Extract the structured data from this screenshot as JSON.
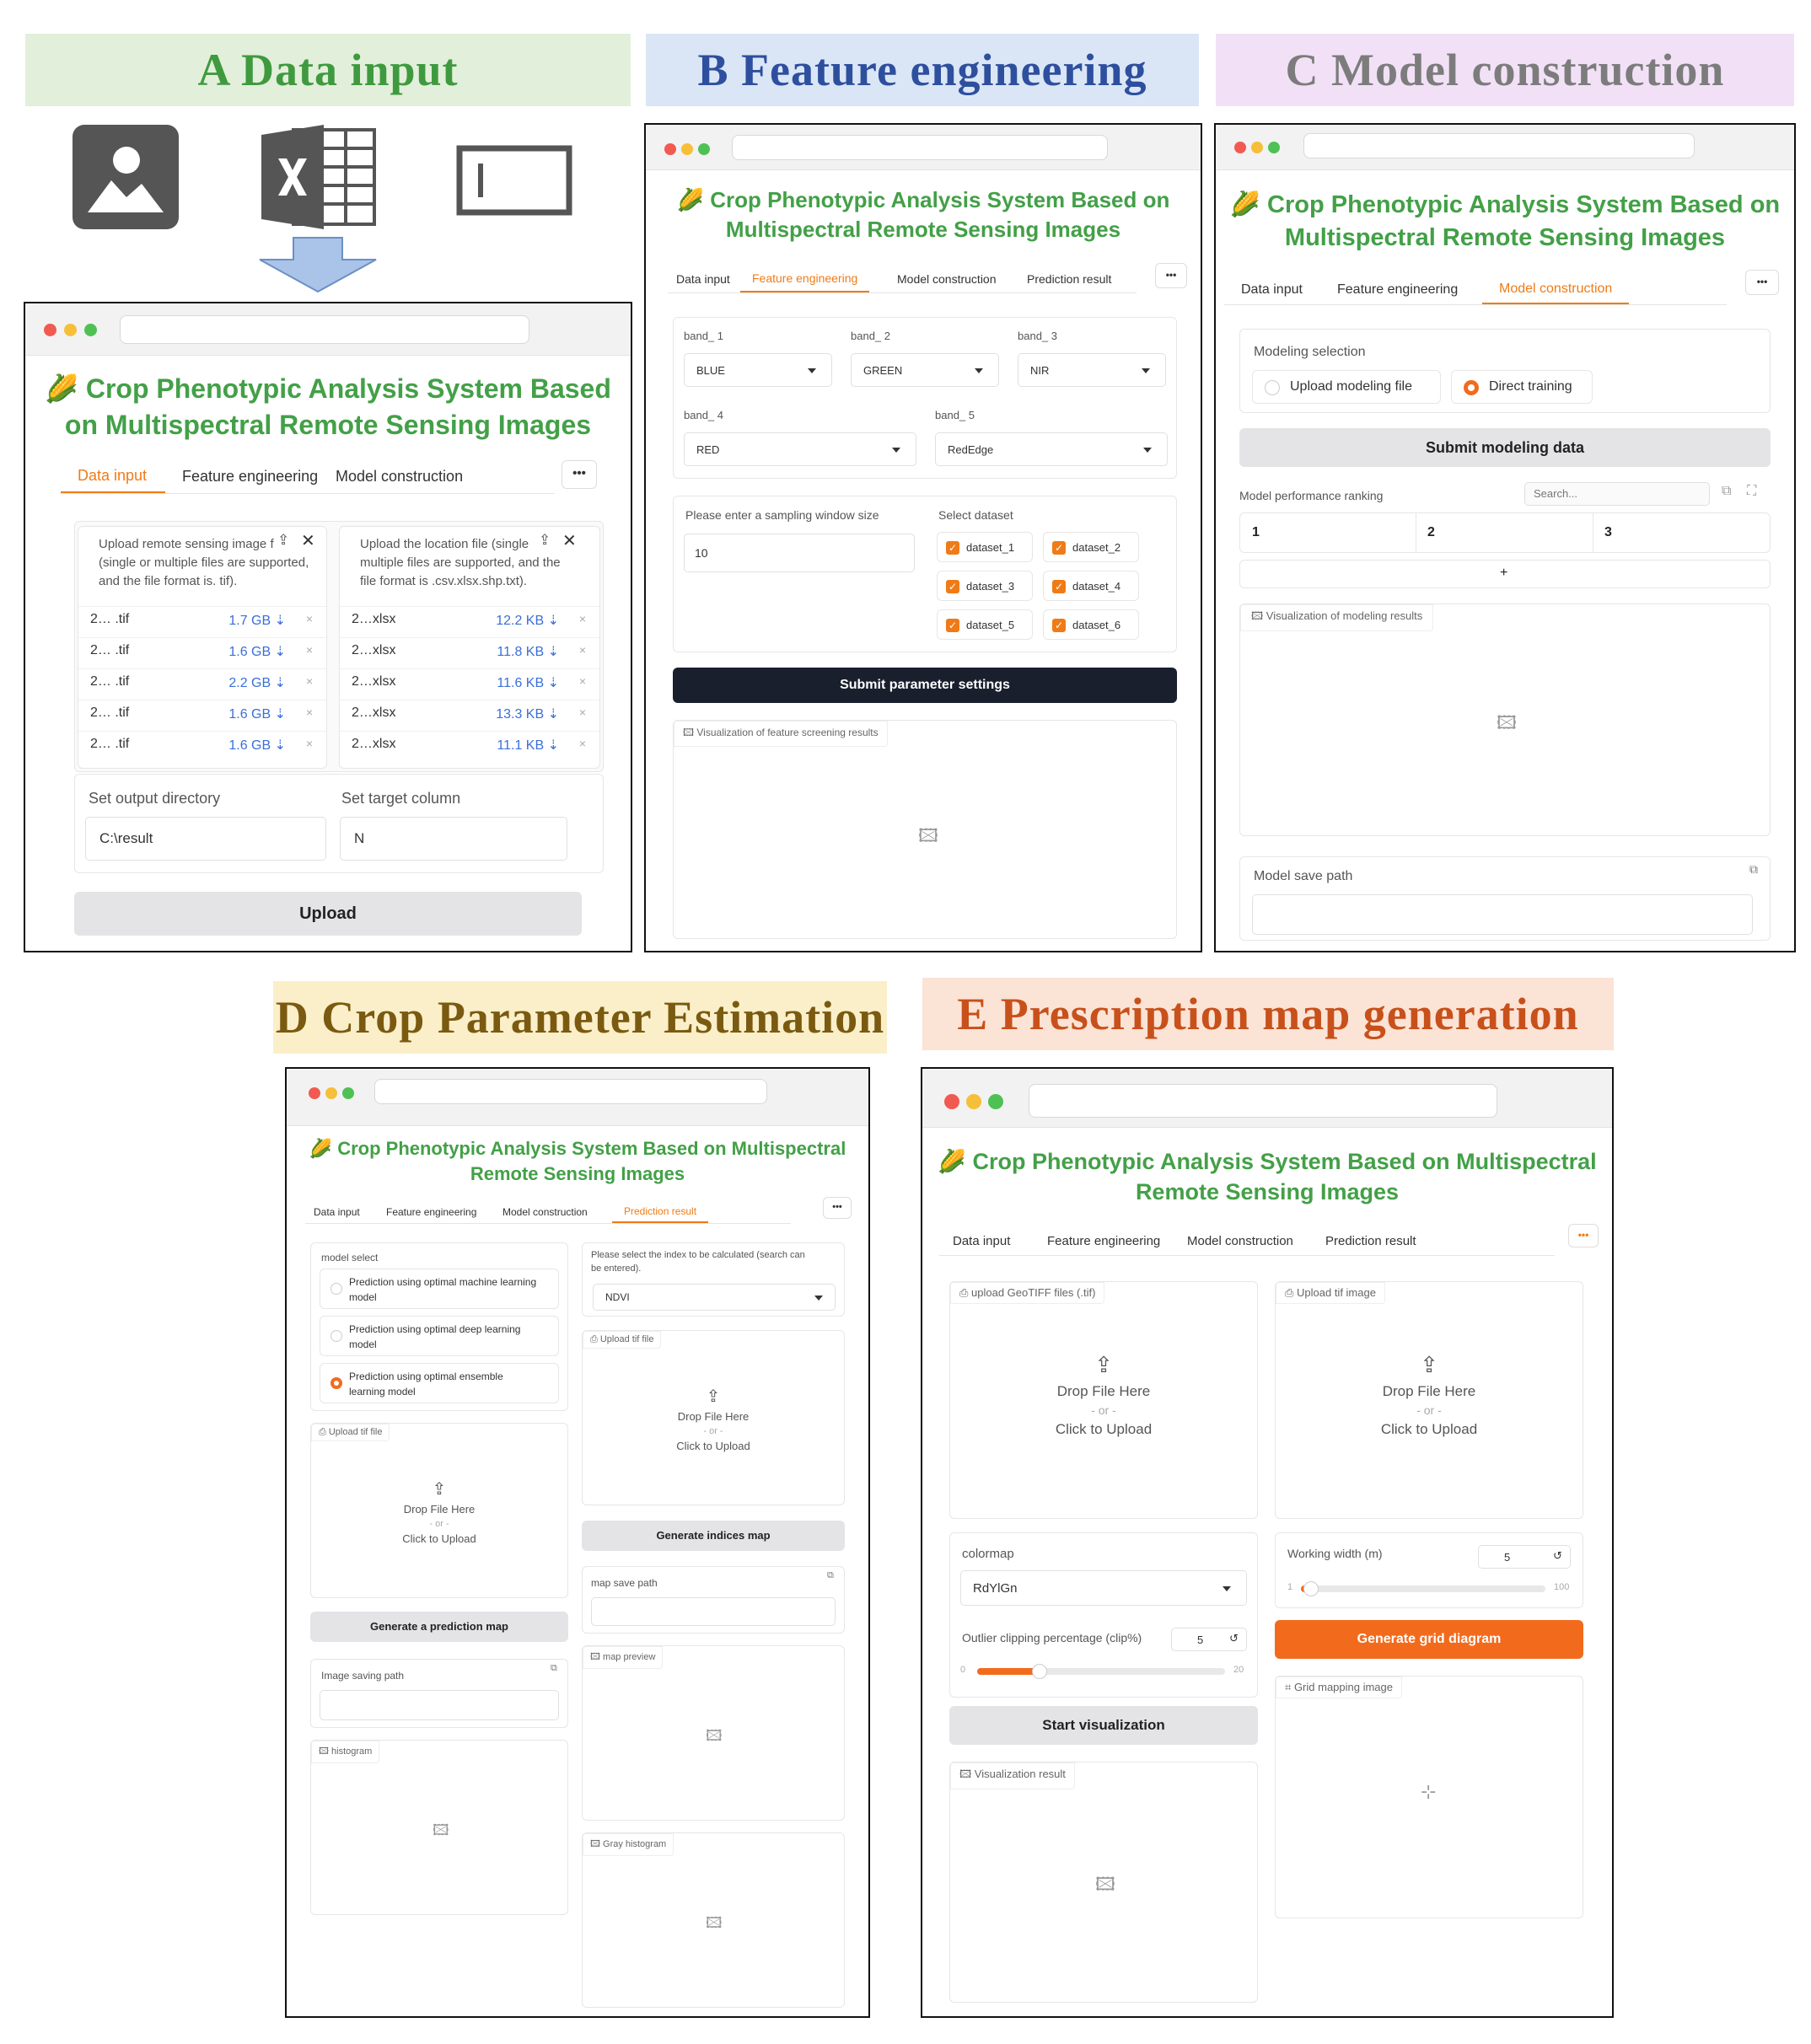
{
  "app": {
    "title_line1_A": "Crop Phenotypic Analysis System Based",
    "title_line2_A": "on Multispectral Remote Sensing Images",
    "title_line1_BC": "Crop Phenotypic Analysis System Based on",
    "title_line2_BC": "Multispectral Remote Sensing Images",
    "title_line1_DE": "Crop Phenotypic Analysis System Based on Multispectral",
    "title_line2_DE": "Remote Sensing Images",
    "title_icon": "corn-icon"
  },
  "banners": {
    "A": "A  Data input",
    "B": "B  Feature engineering",
    "C": "C  Model construction",
    "D": "D  Crop Parameter Estimation",
    "E": "E  Prescription map generation"
  },
  "colors": {
    "A_bg": "#e2efda",
    "A_fg": "#3f9a3f",
    "B_bg": "#dae6f5",
    "B_fg": "#2e4f9e",
    "C_bg": "#f2e1f6",
    "C_fg": "#7c7c7c",
    "D_bg": "#fbefc9",
    "D_fg": "#7a5a10",
    "E_bg": "#fbe3d6",
    "E_fg": "#c8501a",
    "title_green": "#43a047",
    "accent_orange": "#f07b16"
  },
  "input_icons": [
    "image-icon",
    "excel-icon",
    "text-box-icon"
  ],
  "tabs": {
    "data_input": "Data input",
    "feature_engineering": "Feature engineering",
    "model_construction": "Model construction",
    "prediction_result": "Prediction result",
    "more": "•••"
  },
  "panelA": {
    "upload_rs_label_1": "Upload remote sensing image f",
    "upload_rs_label_2": "(single or multiple files are supported,",
    "upload_rs_label_3": "and the file format is. tif).",
    "upload_loc_label_1": "Upload the location file (single",
    "upload_loc_label_2": "multiple files are supported, and the",
    "upload_loc_label_3": "file format is .csv.xlsx.shp.txt).",
    "tif_files": [
      {
        "name": "2… .tif",
        "size": "1.7 GB ⇣"
      },
      {
        "name": "2… .tif",
        "size": "1.6 GB ⇣"
      },
      {
        "name": "2… .tif",
        "size": "2.2 GB ⇣"
      },
      {
        "name": "2… .tif",
        "size": "1.6 GB ⇣"
      },
      {
        "name": "2… .tif",
        "size": "1.6 GB ⇣"
      }
    ],
    "xlsx_files": [
      {
        "name": "2…xlsx",
        "size": "12.2 KB ⇣"
      },
      {
        "name": "2…xlsx",
        "size": "11.8 KB ⇣"
      },
      {
        "name": "2…xlsx",
        "size": "11.6 KB ⇣"
      },
      {
        "name": "2…xlsx",
        "size": "13.3 KB ⇣"
      },
      {
        "name": "2…xlsx",
        "size": "11.1 KB ⇣"
      }
    ],
    "remove": "×",
    "close": "✕",
    "output_dir_label": "Set output directory",
    "output_dir_value": "C:\\result",
    "target_col_label": "Set target column",
    "target_col_value": "N",
    "upload_button": "Upload"
  },
  "panelB": {
    "bands": [
      {
        "label": "band_ 1",
        "value": "BLUE"
      },
      {
        "label": "band_ 2",
        "value": "GREEN"
      },
      {
        "label": "band_ 3",
        "value": "NIR"
      },
      {
        "label": "band_ 4",
        "value": "RED"
      },
      {
        "label": "band_ 5",
        "value": "RedEdge"
      }
    ],
    "window_label": "Please enter a sampling window size",
    "window_value": "10",
    "dataset_label": "Select dataset",
    "datasets": [
      "dataset_1",
      "dataset_2",
      "dataset_3",
      "dataset_4",
      "dataset_5",
      "dataset_6"
    ],
    "submit": "Submit parameter settings",
    "viz_label": "Visualization of feature screening results"
  },
  "panelC": {
    "modeling_label": "Modeling selection",
    "opt_upload": "Upload modeling file",
    "opt_direct": "Direct training",
    "submit": "Submit modeling data",
    "ranking_label": "Model performance ranking",
    "search_placeholder": "Search...",
    "cols": [
      "1",
      "2",
      "3"
    ],
    "add": "+",
    "viz_label": "Visualization of modeling results",
    "save_label": "Model save path"
  },
  "panelD": {
    "model_select": "model select",
    "opt1_1": "Prediction using optimal machine learning",
    "opt1_2": "model",
    "opt2_1": "Prediction using optimal deep learning",
    "opt2_2": "model",
    "opt3_1": "Prediction using optimal ensemble",
    "opt3_2": "learning model",
    "upload_tif": "Upload tif file",
    "drop": "Drop File Here",
    "or": "- or -",
    "click": "Click to Upload",
    "gen_pred": "Generate a prediction map",
    "img_save": "Image saving path",
    "histogram": "histogram",
    "index_label_1": "Please select the index to be calculated (search can",
    "index_label_2": "be entered).",
    "index_value": "NDVI",
    "gen_indices": "Generate indices map",
    "map_save": "map save path",
    "map_preview": "map preview",
    "gray_hist": "Gray histogram"
  },
  "panelE": {
    "upload_geotiff": "upload GeoTIFF files (.tif)",
    "upload_tif_img": "Upload tif image",
    "drop": "Drop File Here",
    "or": "- or -",
    "click": "Click to Upload",
    "colormap_label": "colormap",
    "colormap_value": "RdYlGn",
    "clip_label": "Outlier clipping percentage (clip%)",
    "clip_value": "5",
    "clip_min": "0",
    "clip_max": "20",
    "width_label": "Working width (m)",
    "width_value": "5",
    "width_min": "1",
    "width_max": "100",
    "gen_grid": "Generate grid diagram",
    "start_viz": "Start visualization",
    "viz_result": "Visualization result",
    "grid_img": "Grid mapping image",
    "reset": "↺"
  }
}
